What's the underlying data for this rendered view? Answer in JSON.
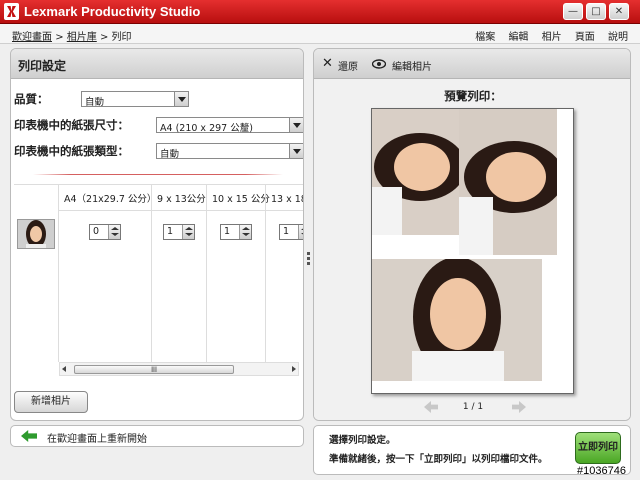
{
  "window": {
    "title": "Lexmark Productivity Studio",
    "min_glyph": "—",
    "max_glyph": "□",
    "close_glyph": "✕"
  },
  "breadcrumb": {
    "home": "歡迎畫面",
    "sep1": ">",
    "gallery": "相片庫",
    "sep2": ">",
    "current": "列印"
  },
  "menu": [
    "檔案",
    "編輯",
    "相片",
    "頁面",
    "說明"
  ],
  "left_panel": {
    "title": "列印設定",
    "quality_label": "品質：",
    "quality_value": "自動",
    "paper_size_label": "印表機中的紙張尺寸：",
    "paper_size_value": "A4 (210 x 297 公釐)",
    "paper_type_label": "印表機中的紙張類型：",
    "paper_type_value": "自動",
    "columns": [
      "A4（21x29.7 公分）",
      "9 x 13公分",
      "10 x 15 公分",
      "13 x 18 公"
    ],
    "quantities": [
      "0",
      "1",
      "1",
      "1"
    ],
    "scroll_grip": "lll",
    "add_photo_button": "新增相片",
    "restart_text": "在歡迎畫面上重新開始"
  },
  "right_panel": {
    "undo_label": "還原",
    "edit_photo_label": "編輯相片",
    "preview_title": "預覽列印：",
    "page_indicator": "1 / 1"
  },
  "footer": {
    "line1": "選擇列印設定。",
    "line2": "準備就緒後，按一下「立即列印」以列印檔印文件。",
    "print_now_button": "立即列印"
  },
  "watermark": "#1036746",
  "colors": {
    "titlebar": "#c41212",
    "print_button": "#6cc43f",
    "restart_arrow": "#2e9b2e"
  }
}
